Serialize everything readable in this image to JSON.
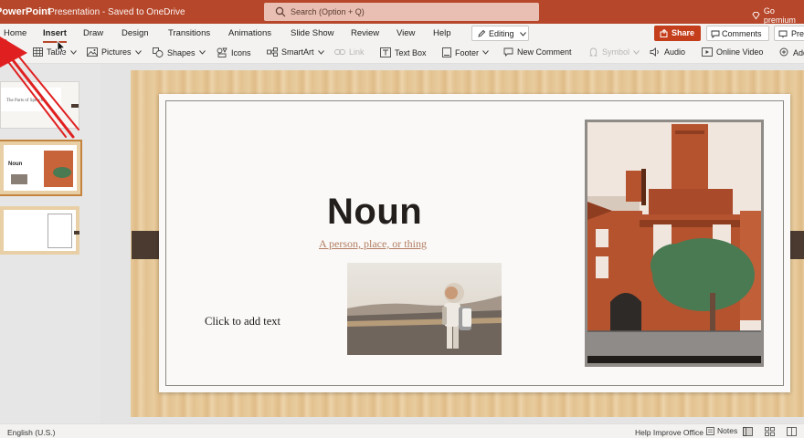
{
  "titlebar": {
    "app_name": "PowerPoint",
    "doc_status": "Presentation  -  Saved to OneDrive",
    "search_placeholder": "Search (Option + Q)",
    "premium": "Go premium"
  },
  "ribbon": {
    "tabs": [
      "Home",
      "Insert",
      "Draw",
      "Design",
      "Transitions",
      "Animations",
      "Slide Show",
      "Review",
      "View",
      "Help"
    ],
    "active_tab": "Insert",
    "mode": "Editing",
    "share": "Share",
    "comments": "Comments",
    "present": "Present"
  },
  "toolbar": {
    "table": "Table",
    "pictures": "Pictures",
    "shapes": "Shapes",
    "icons": "Icons",
    "smartart": "SmartArt",
    "link": "Link",
    "textbox": "Text Box",
    "footer": "Footer",
    "new_comment": "New Comment",
    "symbol": "Symbol",
    "audio": "Audio",
    "online_video": "Online Video",
    "addins": "Add-ins"
  },
  "thumbnails": [
    {
      "title": "The Parts of Speech"
    },
    {
      "title": "Noun"
    },
    {
      "title": ""
    }
  ],
  "slide": {
    "title": "Noun",
    "subtitle": "A person, place, or thing",
    "text_placeholder": "Click to add text"
  },
  "statusbar": {
    "language": "English (U.S.)",
    "help": "Help Improve Office",
    "notes": "Notes"
  },
  "colors": {
    "accent": "#b7472a",
    "share": "#c43e1c",
    "slide_bg": "#faf9f7",
    "wood": "#e8c99a",
    "brick": "#b5532f",
    "tree": "#4a7a52"
  }
}
